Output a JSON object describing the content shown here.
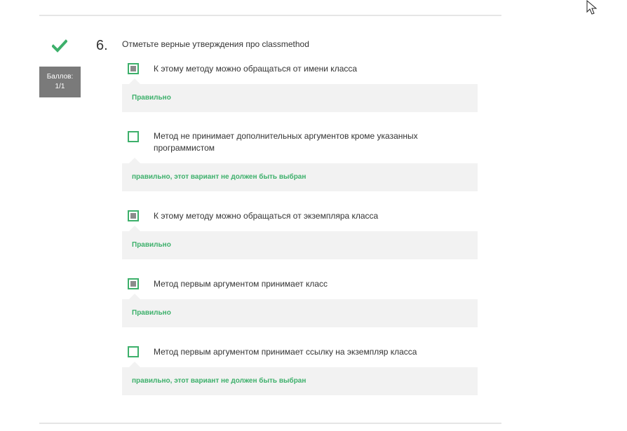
{
  "question": {
    "number": "6.",
    "text": "Отметьте верные утверждения про classmethod",
    "score_label": "Баллов:",
    "score_value": "1/1",
    "status_icon": "checkmark-icon",
    "colors": {
      "correct": "#3db06b",
      "score_bg": "#7a7a7a",
      "feedback_bg": "#f2f2f2"
    }
  },
  "options": [
    {
      "label": "К этому методу можно обращаться от имени класса",
      "checked": true,
      "feedback": "Правильно"
    },
    {
      "label": "Метод не принимает дополнительных аргументов кроме указанных программистом",
      "checked": false,
      "feedback": "правильно, этот вариант не должен быть выбран"
    },
    {
      "label": "К этому методу можно обращаться от экземпляра класса",
      "checked": true,
      "feedback": "Правильно"
    },
    {
      "label": "Метод первым аргументом принимает класс",
      "checked": true,
      "feedback": "Правильно"
    },
    {
      "label": "Метод первым аргументом принимает ссылку на экземпляр класса",
      "checked": false,
      "feedback": "правильно, этот вариант не должен быть выбран"
    }
  ]
}
